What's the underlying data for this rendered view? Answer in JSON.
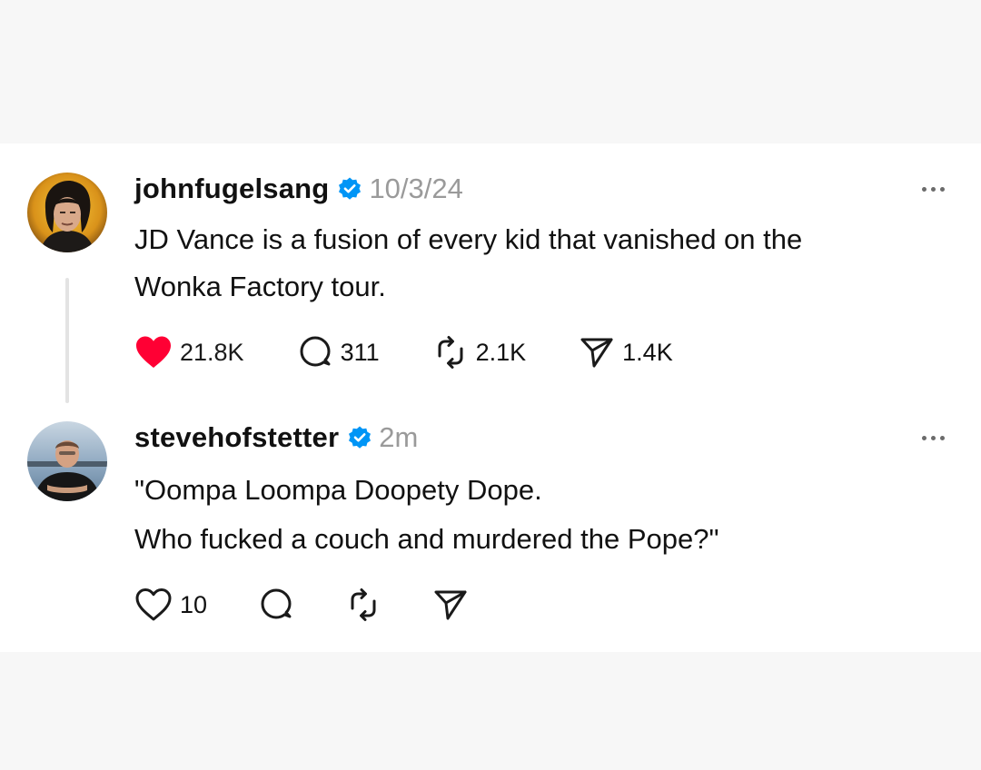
{
  "colors": {
    "like_red": "#ff0034",
    "verified_blue": "#0095f6",
    "muted_gray": "#9a9a9a",
    "icon_dark": "#1a1a1a"
  },
  "posts": [
    {
      "username": "johnfugelsang",
      "verified": true,
      "time": "10/3/24",
      "text_lines": [
        "JD Vance is a fusion of every kid that vanished on the",
        "Wonka Factory tour."
      ],
      "actions": {
        "like": {
          "icon": "heart-filled-icon",
          "count": "21.8K",
          "liked": true
        },
        "comment": {
          "icon": "comment-bubble-icon",
          "count": "311"
        },
        "repost": {
          "icon": "repost-icon",
          "count": "2.1K"
        },
        "share": {
          "icon": "send-icon",
          "count": "1.4K"
        }
      }
    },
    {
      "username": "stevehofstetter",
      "verified": true,
      "time": "2m",
      "text_lines": [
        "\"Oompa Loompa Doopety Dope.",
        "Who fucked a couch and murdered the Pope?\""
      ],
      "actions": {
        "like": {
          "icon": "heart-outline-icon",
          "count": "10",
          "liked": false
        },
        "comment": {
          "icon": "comment-bubble-icon",
          "count": ""
        },
        "repost": {
          "icon": "repost-icon",
          "count": ""
        },
        "share": {
          "icon": "send-icon",
          "count": ""
        }
      }
    }
  ]
}
